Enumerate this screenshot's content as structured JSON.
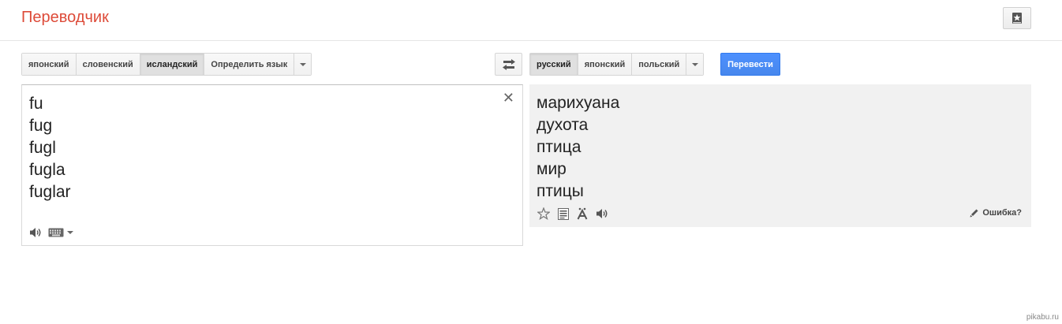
{
  "header": {
    "title": "Переводчик"
  },
  "source_langs": {
    "items": [
      "японский",
      "словенский",
      "исландский",
      "Определить язык"
    ],
    "active_index": 2
  },
  "target_langs": {
    "items": [
      "русский",
      "японский",
      "польский"
    ],
    "active_index": 0
  },
  "translate_button": "Перевести",
  "source": {
    "lines": [
      "fu",
      "fug",
      "fugl",
      "fugla",
      "fuglar"
    ]
  },
  "result": {
    "lines": [
      "марихуана",
      "духота",
      "птица",
      "мир",
      "птицы"
    ],
    "error_link": "Ошибка?"
  },
  "watermark": "pikabu.ru",
  "colors": {
    "title": "#dd4b39",
    "translate_button": "#4d90fe",
    "result_bg": "#f1f1f1"
  },
  "icons": {
    "phrasebook": "phrasebook-star-icon",
    "swap": "swap-arrows-icon",
    "clear": "close-icon",
    "listen": "speaker-icon",
    "keyboard": "keyboard-icon",
    "star": "star-icon",
    "dictionary": "document-icon",
    "romanization": "transliteration-icon",
    "edit": "pencil-icon"
  }
}
